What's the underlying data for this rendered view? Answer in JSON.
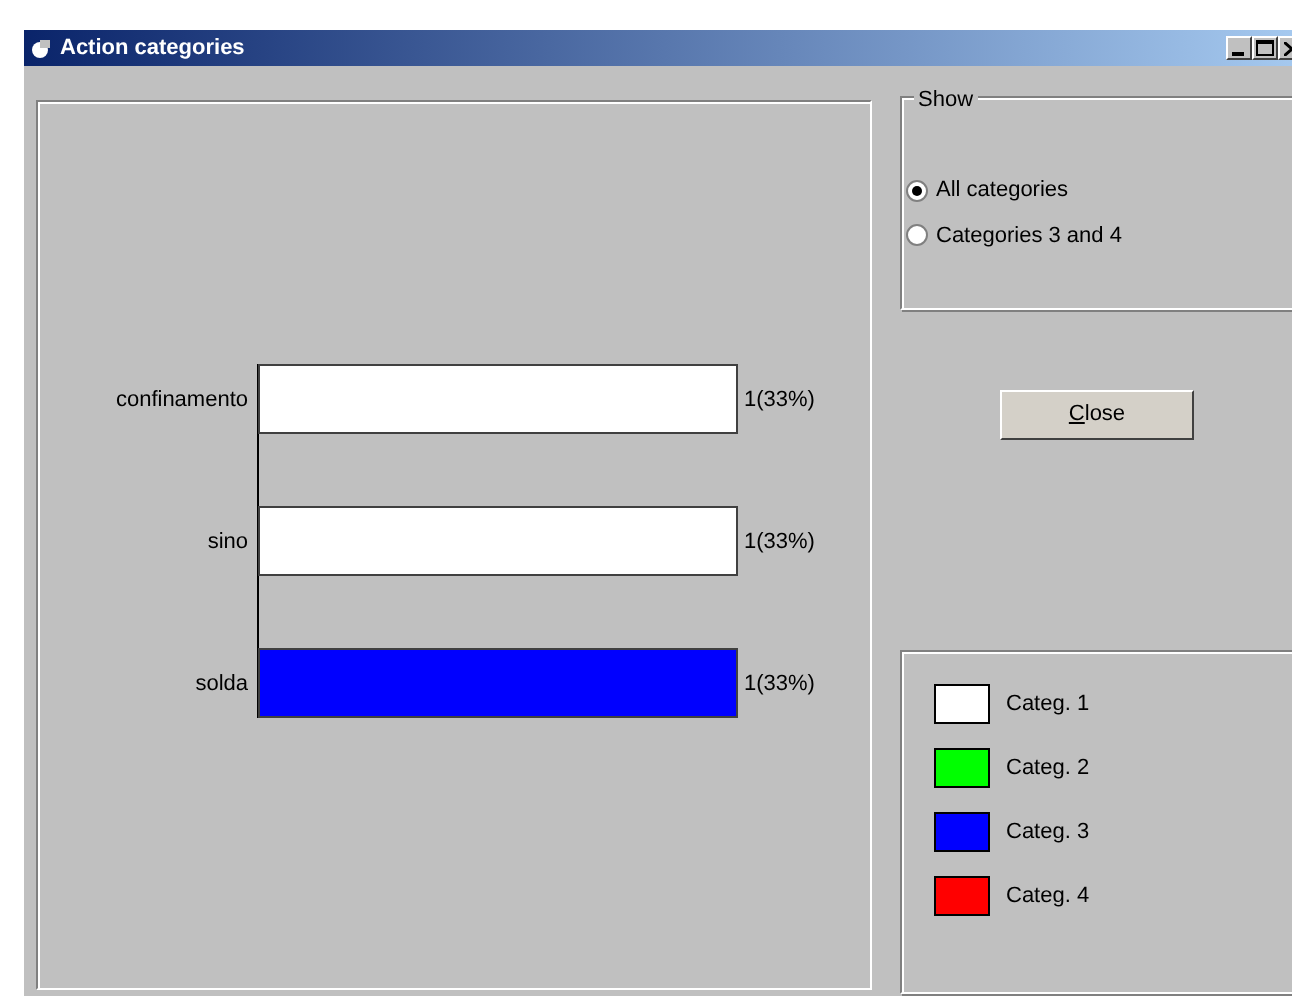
{
  "window": {
    "title": "Action categories"
  },
  "chart": {
    "chart_data": {
      "type": "bar",
      "orientation": "horizontal",
      "categories": [
        "confinamento",
        "sino",
        "solda"
      ],
      "values": [
        1,
        1,
        1
      ],
      "colors": [
        "#ffffff",
        "#ffffff",
        "#0000ff"
      ],
      "value_labels": [
        "1(33%)",
        "1(33%)",
        "1(33%)"
      ]
    }
  },
  "show": {
    "title": "Show",
    "options": [
      {
        "label": "All categories",
        "selected": true
      },
      {
        "label": "Categories 3 and 4",
        "selected": false
      }
    ]
  },
  "close_button": {
    "label": "Close"
  },
  "legend": [
    {
      "label": "Categ. 1",
      "color": "#ffffff"
    },
    {
      "label": "Categ. 2",
      "color": "#00ff00"
    },
    {
      "label": "Categ. 3",
      "color": "#0000ff"
    },
    {
      "label": "Categ. 4",
      "color": "#ff0000"
    }
  ]
}
